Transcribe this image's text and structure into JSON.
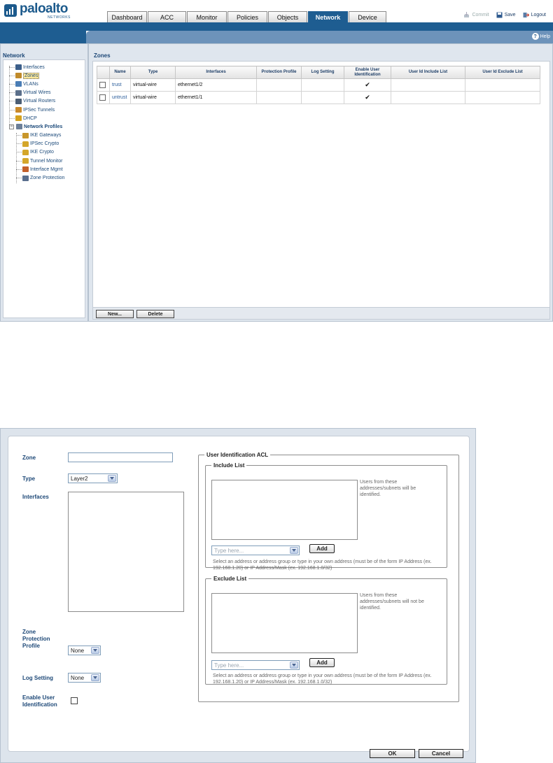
{
  "brand": {
    "logo_text": "paloalto",
    "logo_sub": "NETWORKS",
    "color": "#1e5d91"
  },
  "tabs": [
    {
      "label": "Dashboard",
      "active": false
    },
    {
      "label": "ACC",
      "active": false
    },
    {
      "label": "Monitor",
      "active": false
    },
    {
      "label": "Policies",
      "active": false
    },
    {
      "label": "Objects",
      "active": false
    },
    {
      "label": "Network",
      "active": true
    },
    {
      "label": "Device",
      "active": false
    }
  ],
  "toplinks": {
    "commit": "Commit",
    "save": "Save",
    "logout": "Logout"
  },
  "help_label": "Help",
  "sidebar": {
    "title": "Network",
    "items": [
      {
        "label": "Interfaces",
        "icon": "interfaces-icon",
        "level": 1
      },
      {
        "label": "Zones",
        "icon": "zones-icon",
        "level": 1,
        "selected": true
      },
      {
        "label": "VLANs",
        "icon": "vlans-icon",
        "level": 1
      },
      {
        "label": "Virtual Wires",
        "icon": "virtual-wires-icon",
        "level": 1
      },
      {
        "label": "Virtual Routers",
        "icon": "virtual-routers-icon",
        "level": 1
      },
      {
        "label": "IPSec Tunnels",
        "icon": "ipsec-tunnels-icon",
        "level": 1
      },
      {
        "label": "DHCP",
        "icon": "dhcp-icon",
        "level": 1
      },
      {
        "label": "Network Profiles",
        "icon": "network-profiles-icon",
        "level": 1,
        "expanded": true
      },
      {
        "label": "IKE Gateways",
        "icon": "ike-gateways-icon",
        "level": 2
      },
      {
        "label": "IPSec Crypto",
        "icon": "lock-icon",
        "level": 2
      },
      {
        "label": "IKE Crypto",
        "icon": "lock-icon",
        "level": 2
      },
      {
        "label": "Tunnel Monitor",
        "icon": "lock-icon",
        "level": 2
      },
      {
        "label": "Interface Mgmt",
        "icon": "interface-mgmt-icon",
        "level": 2
      },
      {
        "label": "Zone Protection",
        "icon": "zone-protection-icon",
        "level": 2
      }
    ]
  },
  "zones": {
    "title": "Zones",
    "columns": [
      "Name",
      "Type",
      "Interfaces",
      "Protection Profile",
      "Log Setting",
      "Enable User Identification",
      "User Id Include List",
      "User Id Exclude List"
    ],
    "rows": [
      {
        "name": "trust",
        "type": "virtual-wire",
        "interfaces": "ethernet1/2",
        "protection_profile": "",
        "log_setting": "",
        "user_id": true,
        "include": "",
        "exclude": ""
      },
      {
        "name": "untrust",
        "type": "virtual-wire",
        "interfaces": "ethernet1/1",
        "protection_profile": "",
        "log_setting": "",
        "user_id": true,
        "include": "",
        "exclude": ""
      }
    ],
    "new_label": "New...",
    "delete_label": "Delete"
  },
  "dialog": {
    "zone_label": "Zone",
    "zone_value": "",
    "type_label": "Type",
    "type_value": "Layer2",
    "interfaces_label": "Interfaces",
    "zpp_label": "Zone Protection Profile",
    "zpp_value": "None",
    "log_label": "Log Setting",
    "log_value": "None",
    "enable_uid_label": "Enable User Identification",
    "enable_uid_checked": false,
    "uid_acl_legend": "User Identification ACL",
    "include": {
      "legend": "Include List",
      "note": "Users from these addresses/subnets will be identified.",
      "placeholder": "Type here...",
      "add_label": "Add",
      "help": "Select an address or address group or type in your own address (must be of the form IP Address (ex. 192.168.1.20) or IP Address/Mask (ex. 192.168.1.0/32)"
    },
    "exclude": {
      "legend": "Exclude List",
      "note": "Users from these addresses/subnets will not be identified.",
      "placeholder": "Type here...",
      "add_label": "Add",
      "help": "Select an address or address group or type in your own address (must be of the form IP Address (ex. 192.168.1.20) or IP Address/Mask (ex. 192.168.1.0/32)"
    },
    "ok_label": "OK",
    "cancel_label": "Cancel"
  }
}
